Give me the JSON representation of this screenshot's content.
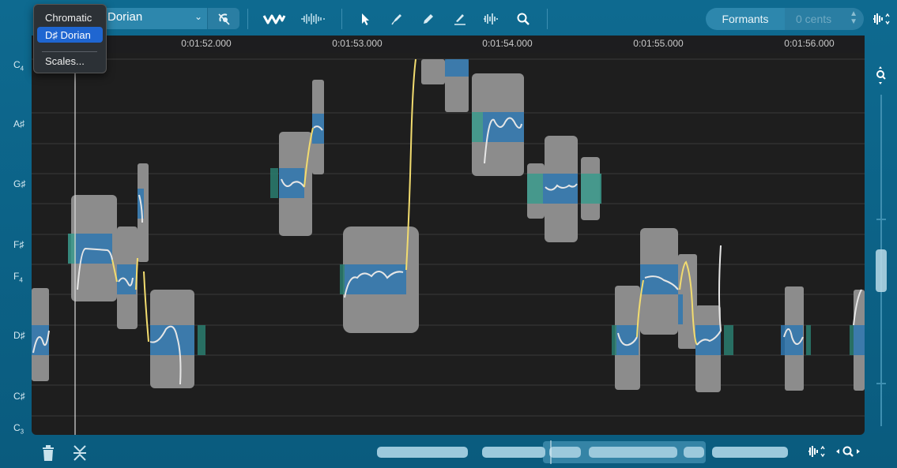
{
  "toolbar": {
    "scale_value": "Dorian",
    "formants_label": "Formants",
    "cents_placeholder": "0 cents"
  },
  "scale_menu": {
    "items": [
      "Chromatic",
      "D♯ Dorian",
      "Scales..."
    ],
    "selected": "D♯ Dorian"
  },
  "ruler": {
    "times": [
      "0:01:52.000",
      "0:01:53.000",
      "0:01:54.000",
      "0:01:55.000",
      "0:01:56.000"
    ]
  },
  "piano_keys": [
    {
      "note": "C",
      "sub": "4"
    },
    {
      "note": "A♯",
      "sub": ""
    },
    {
      "note": "G♯",
      "sub": ""
    },
    {
      "note": "F♯",
      "sub": ""
    },
    {
      "note": "F",
      "sub": "4"
    },
    {
      "note": "D♯",
      "sub": ""
    },
    {
      "note": "C♯",
      "sub": ""
    },
    {
      "note": "C",
      "sub": "3"
    }
  ],
  "icons": {
    "snap": "snap-to-pitch-icon",
    "pitch_tool": "pitch-wave-icon",
    "amplitude_tool": "amplitude-icon",
    "select_tool": "arrow-pointer-icon",
    "pitch_draw": "pitch-pen-icon",
    "pencil": "pencil-icon",
    "line": "line-tool-icon",
    "time_tool": "time-stretch-icon",
    "zoom_tool": "magnifier-icon",
    "delete": "trash-icon",
    "split": "split-icon"
  },
  "colors": {
    "accent": "#0e6a90",
    "note_blue": "#2e77b0",
    "note_teal": "#3a9a8c",
    "pitch_curve": "#f2dc6f",
    "waveform": "#8a8a8a"
  }
}
